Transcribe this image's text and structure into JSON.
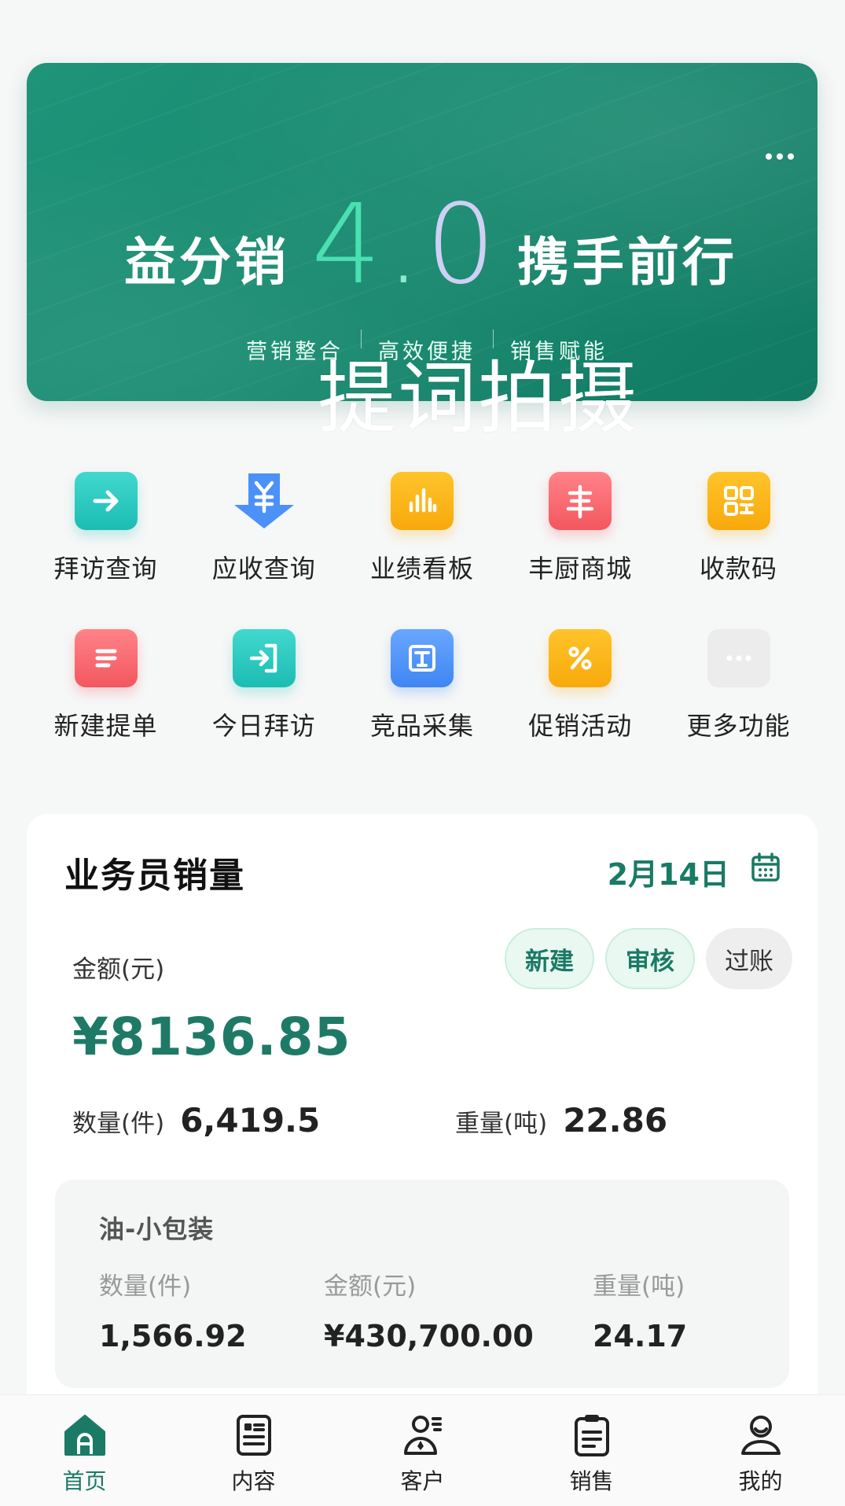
{
  "banner": {
    "title_left": "益分销",
    "version_digit": "4",
    "version_dot": ".",
    "version_zero": "0",
    "title_right": "携手前行",
    "tags": [
      "营销整合",
      "高效便捷",
      "销售赋能"
    ],
    "watermark": "提词拍摄"
  },
  "quick_actions": [
    {
      "label": "拜访查询",
      "icon": "arrow-right-icon",
      "color": "#2cc8bf"
    },
    {
      "label": "应收查询",
      "icon": "yuan-arrow-down-icon",
      "color": "#4b91f7"
    },
    {
      "label": "业绩看板",
      "icon": "bar-chart-icon",
      "color": "#fbb51a"
    },
    {
      "label": "丰厨商城",
      "icon": "feng-char-icon",
      "color": "#f76a70"
    },
    {
      "label": "收款码",
      "icon": "qr-code-icon",
      "color": "#fbb51a"
    },
    {
      "label": "新建提单",
      "icon": "document-lines-icon",
      "color": "#f76a70"
    },
    {
      "label": "今日拜访",
      "icon": "login-arrow-icon",
      "color": "#2cc8bf"
    },
    {
      "label": "竞品采集",
      "icon": "text-t-icon",
      "color": "#4b91f7"
    },
    {
      "label": "促销活动",
      "icon": "percent-ticket-icon",
      "color": "#fbb51a"
    },
    {
      "label": "更多功能",
      "icon": "more-dots-icon",
      "color": "#ececec"
    }
  ],
  "sales": {
    "title": "业务员销量",
    "date": "2月14日",
    "amount_label": "金额(元)",
    "amount": "¥8136.85",
    "pills": [
      "新建",
      "审核",
      "过账"
    ],
    "qty_label": "数量(件)",
    "qty": "6,419.5",
    "weight_label": "重量(吨)",
    "weight": "22.86",
    "sub": {
      "title": "油-小包装",
      "qty_label": "数量(件)",
      "qty": "1,566.92",
      "amount_label": "金额(元)",
      "amount": "¥430,700.00",
      "weight_label": "重量(吨)",
      "weight": "24.17"
    }
  },
  "tabbar": [
    {
      "label": "首页",
      "active": true
    },
    {
      "label": "内容",
      "active": false
    },
    {
      "label": "客户",
      "active": false
    },
    {
      "label": "销售",
      "active": false
    },
    {
      "label": "我的",
      "active": false
    }
  ],
  "colors": {
    "brand": "#1a7a66",
    "banner": "#178a70"
  }
}
